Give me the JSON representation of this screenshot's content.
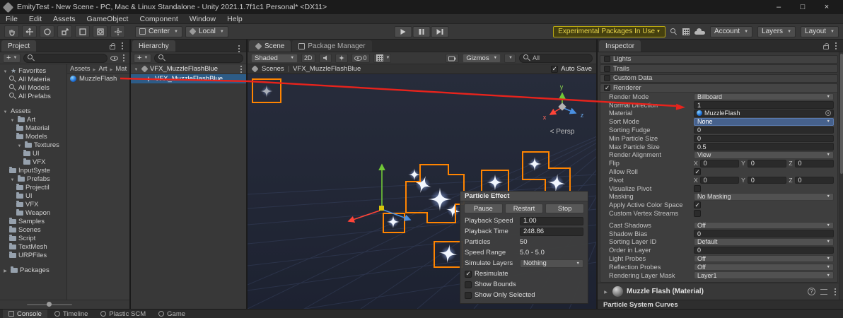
{
  "title_bar": {
    "title": "EmityTest - New Scene - PC, Mac & Linux Standalone - Unity 2021.1.7f1c1 Personal* <DX11>"
  },
  "window_controls": {
    "min": "–",
    "max": "□",
    "close": "×"
  },
  "menu": {
    "items": [
      "File",
      "Edit",
      "Assets",
      "GameObject",
      "Component",
      "Window",
      "Help"
    ]
  },
  "toolbar": {
    "pivot": "Center",
    "rotation": "Local",
    "experimental": "Experimental Packages In Use",
    "account": "Account",
    "layers": "Layers",
    "layout": "Layout"
  },
  "project": {
    "tab": "Project",
    "favorites": {
      "header": "Favorites",
      "items": [
        "All Materia",
        "All Models",
        "All Prefabs"
      ]
    },
    "tree": {
      "root": "Assets",
      "items": [
        "Art",
        "Material",
        "Models",
        "Textures",
        "UI",
        "VFX",
        "InputSyste",
        "Prefabs",
        "Projectil",
        "UI",
        "VFX",
        "Weapon",
        "Samples",
        "Scenes",
        "Script",
        "TextMesh",
        "URPFiles"
      ],
      "packages": "Packages"
    },
    "breadcrumb": [
      "Assets",
      "Art",
      "Mat"
    ],
    "selected_asset": "MuzzleFlash"
  },
  "hierarchy": {
    "tab": "Hierarchy",
    "scene": "VFX_MuzzleFlashBlue",
    "object": "VFX_MuzzleFlashBlue"
  },
  "scene": {
    "tab": "Scene",
    "tab2": "Package Manager",
    "draw_mode": "Shaded",
    "mode_2d": "2D",
    "hidden_count": "0",
    "gizmos": "Gizmos",
    "search_value": "All",
    "breadcrumb_root": "Scenes",
    "breadcrumb_current": "VFX_MuzzleFlashBlue",
    "auto_save": "Auto Save",
    "auto_save_checked": true,
    "camera_label": "< Persp",
    "axis": {
      "x": "x",
      "y": "y",
      "z": "z"
    }
  },
  "particle_panel": {
    "title": "Particle Effect",
    "buttons": [
      "Pause",
      "Restart",
      "Stop"
    ],
    "rows": [
      {
        "label": "Playback Speed",
        "value": "1.00"
      },
      {
        "label": "Playback Time",
        "value": "248.86"
      },
      {
        "label": "Particles",
        "value": "50"
      },
      {
        "label": "Speed Range",
        "value": "5.0 - 5.0"
      },
      {
        "label": "Simulate Layers",
        "value": "Nothing"
      }
    ],
    "checks": [
      {
        "label": "Resimulate",
        "checked": true
      },
      {
        "label": "Show Bounds",
        "checked": false
      },
      {
        "label": "Show Only Selected",
        "checked": false
      }
    ]
  },
  "inspector": {
    "tab": "Inspector",
    "modules": [
      {
        "label": "Lights",
        "checked": false
      },
      {
        "label": "Trails",
        "checked": false
      },
      {
        "label": "Custom Data",
        "checked": false
      },
      {
        "label": "Renderer",
        "checked": true
      }
    ],
    "axis": {
      "x": "X",
      "y": "Y",
      "z": "Z"
    },
    "rows": [
      {
        "label": "Render Mode",
        "value": "Billboard"
      },
      {
        "label": "Normal Direction",
        "value": "1"
      },
      {
        "label": "Material",
        "value": "MuzzleFlash"
      },
      {
        "label": "Sort Mode",
        "value": "None"
      },
      {
        "label": "Sorting Fudge",
        "value": "0"
      },
      {
        "label": "Min Particle Size",
        "value": "0"
      },
      {
        "label": "Max Particle Size",
        "value": "0.5"
      },
      {
        "label": "Render Alignment",
        "value": "View"
      },
      {
        "label": "Flip",
        "x": "0",
        "y": "0",
        "z": "0"
      },
      {
        "label": "Allow Roll",
        "checked": true
      },
      {
        "label": "Pivot",
        "x": "0",
        "y": "0",
        "z": "0"
      },
      {
        "label": "Visualize Pivot",
        "checked": false
      },
      {
        "label": "Masking",
        "value": "No Masking"
      },
      {
        "label": "Apply Active Color Space",
        "checked": true
      },
      {
        "label": "Custom Vertex Streams",
        "checked": false
      },
      {
        "label": "Cast Shadows",
        "value": "Off"
      },
      {
        "label": "Shadow Bias",
        "value": "0"
      },
      {
        "label": "Sorting Layer ID",
        "value": "Default"
      },
      {
        "label": "Order in Layer",
        "value": "0"
      },
      {
        "label": "Light Probes",
        "value": "Off"
      },
      {
        "label": "Reflection Probes",
        "value": "Off"
      },
      {
        "label": "Rendering Layer Mask",
        "value": "Layer1"
      }
    ],
    "material_section": "Muzzle Flash (Material)",
    "curves_section": "Particle System Curves"
  },
  "status": {
    "tabs": [
      "Console",
      "Timeline",
      "Plastic SCM",
      "Game"
    ]
  },
  "colors": {
    "selection": "#2d5c87",
    "outline_orange": "#ff8400",
    "annotation_red": "#e8231c"
  }
}
